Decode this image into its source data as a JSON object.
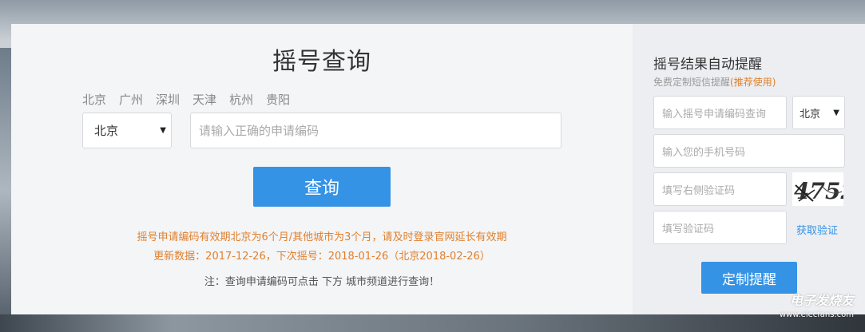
{
  "main": {
    "title": "摇号查询",
    "cities": [
      "北京",
      "广州",
      "深圳",
      "天津",
      "杭州",
      "贵阳"
    ],
    "city_select": "北京",
    "code_input_placeholder": "请输入正确的申请编码",
    "query_button": "查询",
    "note_line1": "摇号申请编码有效期北京为6个月/其他城市为3个月，请及时登录官网延长有效期",
    "note_line2": "更新数据：2017-12-26，下次摇号：2018-01-26（北京2018-02-26）",
    "note_line3": "注：查询申请编码可点击 下方 城市频道进行查询！"
  },
  "side": {
    "title": "摇号结果自动提醒",
    "subtitle_prefix": "免费定制短信提醒",
    "subtitle_highlight": "(推荐使用)",
    "code_input_placeholder": "输入摇号申请编码查询",
    "city_select": "北京",
    "phone_input_placeholder": "输入您的手机号码",
    "captcha_input_placeholder": "填写右侧验证码",
    "captcha_text": "4752",
    "sms_code_placeholder": "填写验证码",
    "get_code_link": "获取验证",
    "submit_button": "定制提醒"
  },
  "watermark": {
    "name": "电子发烧友",
    "url": "www.elecfans.com"
  },
  "colors": {
    "accent": "#3593e6",
    "warning": "#e0802c"
  }
}
